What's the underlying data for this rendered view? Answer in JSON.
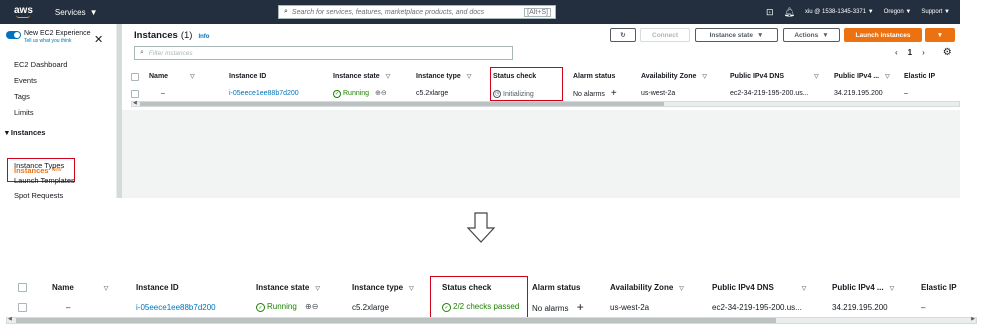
{
  "topnav": {
    "logo": "aws",
    "services_label": "Services",
    "search_placeholder": "Search for services, features, marketplace products, and docs",
    "search_shortcut": "[Alt+S]",
    "account": "xiu @ 1538-1345-3371",
    "region": "Oregon",
    "support": "Support"
  },
  "sidebar": {
    "experience_title": "New EC2 Experience",
    "experience_sub": "Tell us what you think",
    "dashboard": "EC2 Dashboard",
    "events": "Events",
    "tags": "Tags",
    "limits": "Limits",
    "section_instances": "Instances",
    "active_item": "Instances",
    "active_badge": "New",
    "instance_types": "Instance Types",
    "launch_templates": "Launch Templates",
    "spot_requests": "Spot Requests"
  },
  "main": {
    "title": "Instances",
    "count": "(1)",
    "info": "Info",
    "connect": "Connect",
    "instance_state": "Instance state",
    "actions": "Actions",
    "launch": "Launch instances",
    "filter_placeholder": "Filter instances",
    "page": "1"
  },
  "columns": [
    "Name",
    "Instance ID",
    "Instance state",
    "Instance type",
    "Status check",
    "Alarm status",
    "Availability Zone",
    "Public IPv4 DNS",
    "Public IPv4 ...",
    "Elastic IP"
  ],
  "row_before": {
    "name": "–",
    "instance_id": "i-05eece1ee88b7d200",
    "state": "Running",
    "type": "c5.2xlarge",
    "status": "Initializing",
    "alarm": "No alarms",
    "az": "us-west-2a",
    "dns": "ec2-34-219-195-200.us...",
    "ip": "34.219.195.200",
    "eip": "–"
  },
  "row_after": {
    "name": "–",
    "instance_id": "i-05eece1ee88b7d200",
    "state": "Running",
    "type": "c5.2xlarge",
    "status": "2/2 checks passed",
    "alarm": "No alarms",
    "az": "us-west-2a",
    "dns": "ec2-34-219-195-200.us...",
    "ip": "34.219.195.200",
    "eip": "–"
  },
  "colors": {
    "accent": "#ec7211",
    "link": "#0073bb",
    "ok": "#1d8102",
    "highlight": "#d0021b",
    "nav": "#232f3e"
  }
}
